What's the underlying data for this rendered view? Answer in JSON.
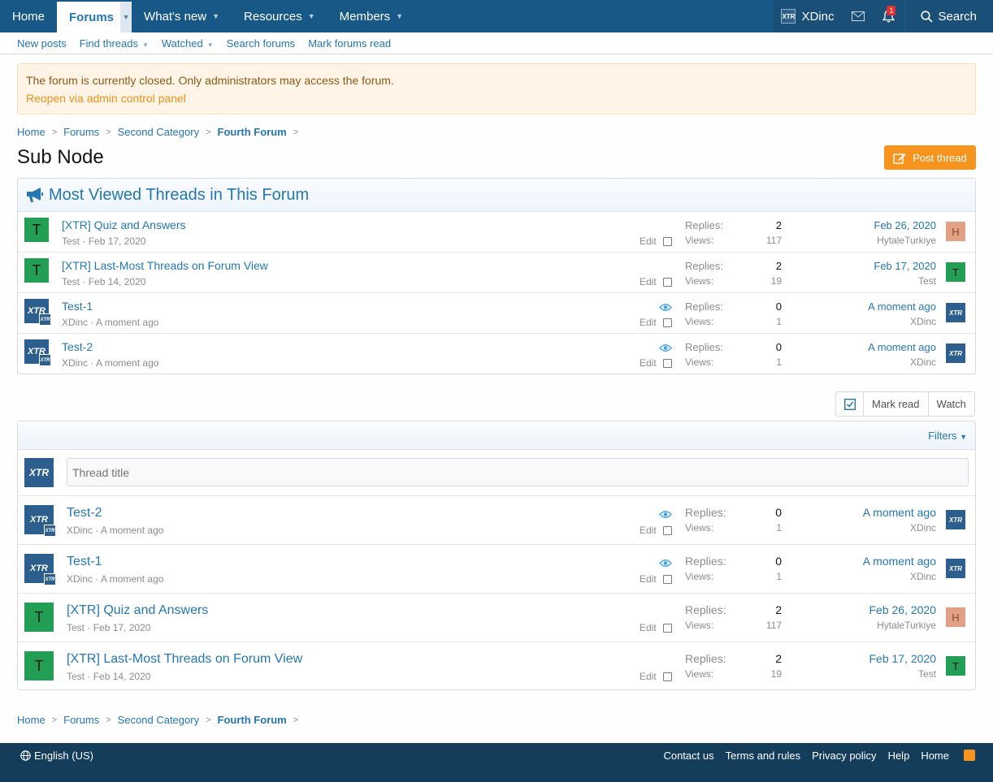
{
  "nav": {
    "tabs": [
      "Home",
      "Forums",
      "What's new",
      "Resources",
      "Members"
    ],
    "user": "XDinc",
    "alert_count": "1",
    "search": "Search"
  },
  "subnav": [
    "New posts",
    "Find threads",
    "Watched",
    "Search forums",
    "Mark forums read"
  ],
  "notice": {
    "text": "The forum is currently closed. Only administrators may access the forum.",
    "link": "Reopen via admin control panel"
  },
  "breadcrumb": [
    "Home",
    "Forums",
    "Second Category",
    "Fourth Forum"
  ],
  "page_title": "Sub Node",
  "post_thread": "Post thread",
  "most_viewed": {
    "title": "Most Viewed Threads in This Forum",
    "threads": [
      {
        "title": "[XTR] Quiz and Answers",
        "author": "Test",
        "date": "Feb 17, 2020",
        "avatar": "T",
        "replies": "2",
        "views": "117",
        "last_date": "Feb 26, 2020",
        "last_user": "HytaleTurkiye",
        "last_avatar": "H",
        "watched": false
      },
      {
        "title": "[XTR] Last-Most Threads on Forum View",
        "author": "Test",
        "date": "Feb 14, 2020",
        "avatar": "T",
        "replies": "2",
        "views": "19",
        "last_date": "Feb 17, 2020",
        "last_user": "Test",
        "last_avatar": "T",
        "watched": false
      },
      {
        "title": "Test-1",
        "author": "XDinc",
        "date": "A moment ago",
        "avatar": "XTR",
        "replies": "0",
        "views": "1",
        "last_date": "A moment ago",
        "last_user": "XDinc",
        "last_avatar": "XTR",
        "watched": true
      },
      {
        "title": "Test-2",
        "author": "XDinc",
        "date": "A moment ago",
        "avatar": "XTR",
        "replies": "0",
        "views": "1",
        "last_date": "A moment ago",
        "last_user": "XDinc",
        "last_avatar": "XTR",
        "watched": true
      }
    ]
  },
  "labels": {
    "replies": "Replies:",
    "views": "Views:",
    "edit": "Edit",
    "mark_read": "Mark read",
    "watch": "Watch",
    "filters": "Filters"
  },
  "quick_thread_placeholder": "Thread title",
  "threads": [
    {
      "title": "Test-2",
      "author": "XDinc",
      "date": "A moment ago",
      "avatar": "XTR",
      "replies": "0",
      "views": "1",
      "last_date": "A moment ago",
      "last_user": "XDinc",
      "last_avatar": "XTR",
      "watched": true
    },
    {
      "title": "Test-1",
      "author": "XDinc",
      "date": "A moment ago",
      "avatar": "XTR",
      "replies": "0",
      "views": "1",
      "last_date": "A moment ago",
      "last_user": "XDinc",
      "last_avatar": "XTR",
      "watched": true
    },
    {
      "title": "[XTR] Quiz and Answers",
      "author": "Test",
      "date": "Feb 17, 2020",
      "avatar": "T",
      "replies": "2",
      "views": "117",
      "last_date": "Feb 26, 2020",
      "last_user": "HytaleTurkiye",
      "last_avatar": "H",
      "watched": false
    },
    {
      "title": "[XTR] Last-Most Threads on Forum View",
      "author": "Test",
      "date": "Feb 14, 2020",
      "avatar": "T",
      "replies": "2",
      "views": "19",
      "last_date": "Feb 17, 2020",
      "last_user": "Test",
      "last_avatar": "T",
      "watched": false
    }
  ],
  "footer": {
    "language": "English (US)",
    "links": [
      "Contact us",
      "Terms and rules",
      "Privacy policy",
      "Help",
      "Home"
    ]
  },
  "colors": {
    "nav": "#185886",
    "link": "#2577b1",
    "accent": "#f7941d",
    "footer": "#143d5c"
  }
}
